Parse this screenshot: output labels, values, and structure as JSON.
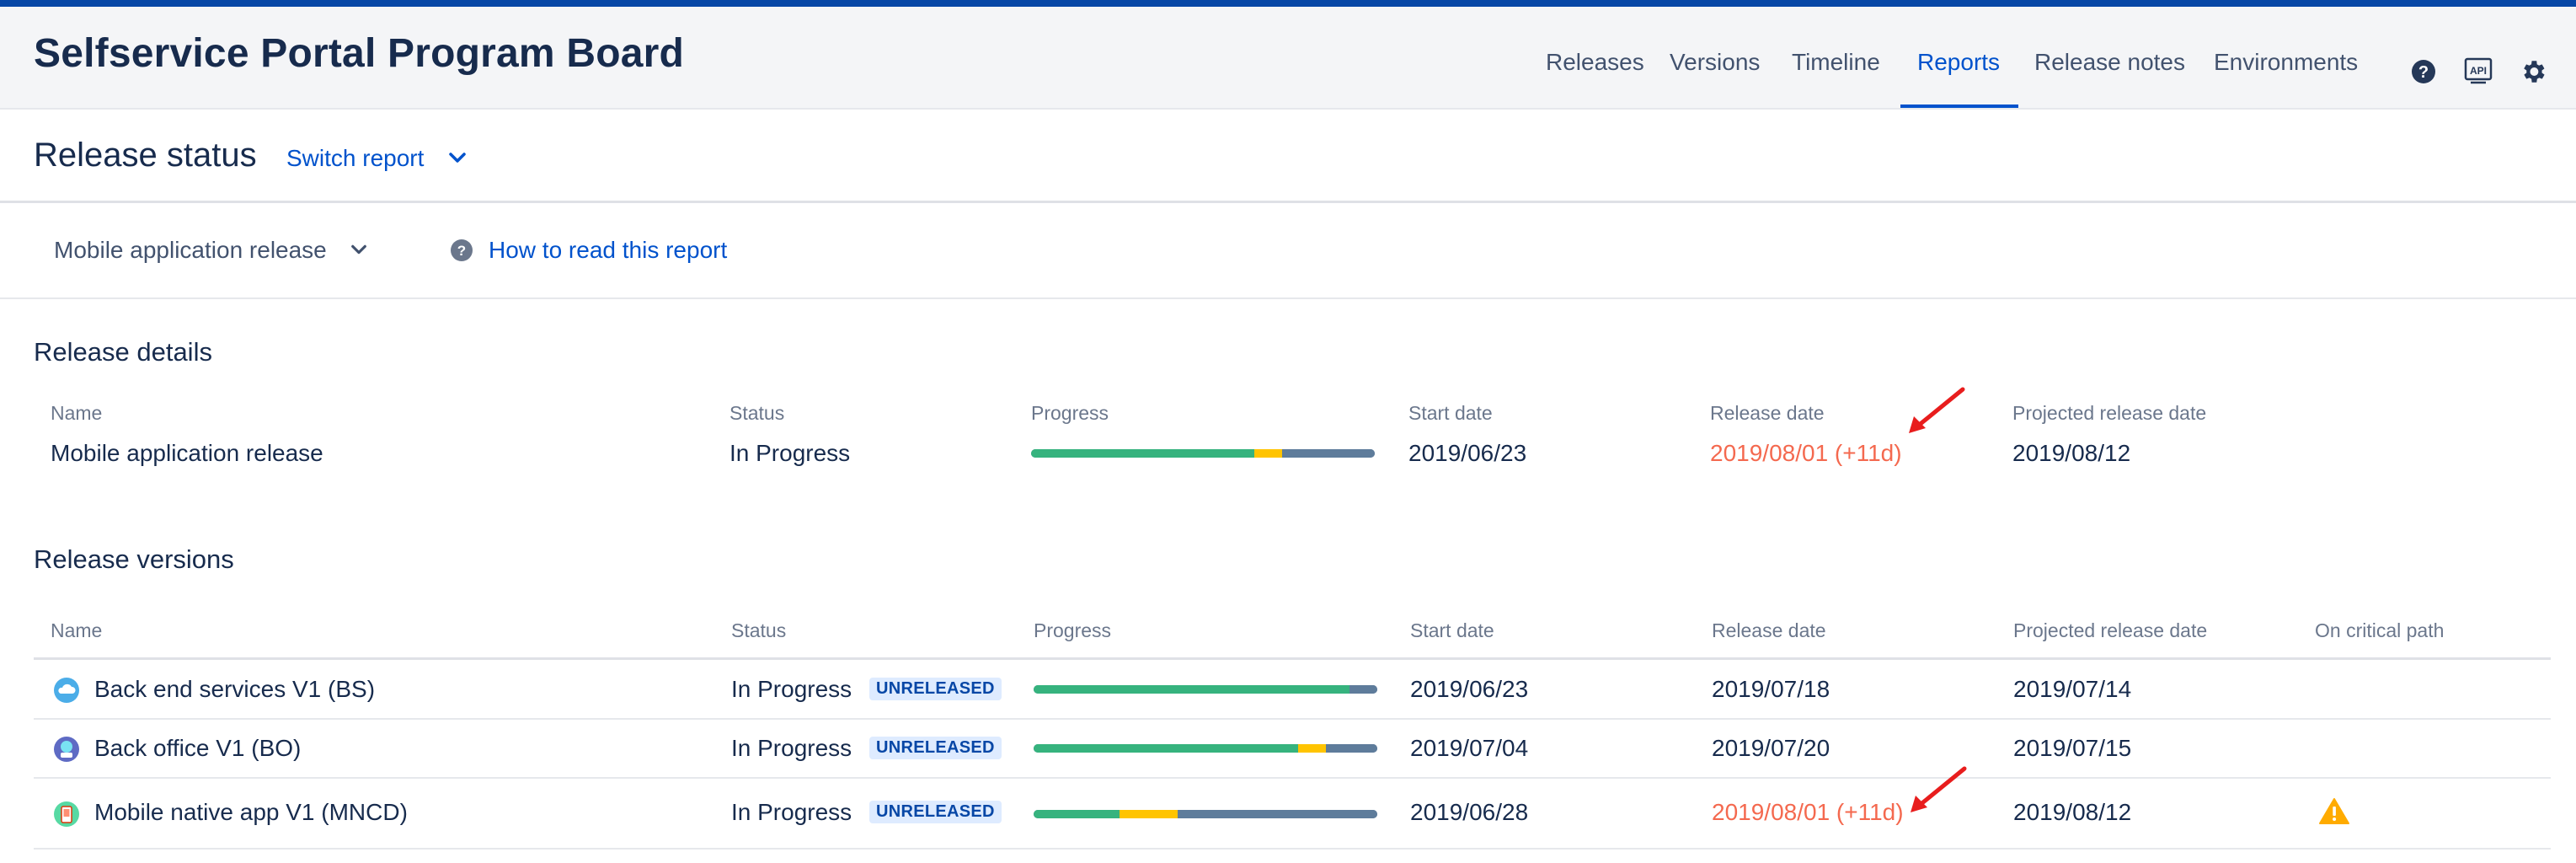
{
  "header": {
    "title": "Selfservice Portal Program Board",
    "nav": [
      "Releases",
      "Versions",
      "Timeline",
      "Reports",
      "Release notes",
      "Environments"
    ],
    "active_nav": "Reports",
    "icons": [
      "help-icon",
      "api-icon",
      "settings-icon"
    ]
  },
  "subheader": {
    "page_title": "Release status",
    "switch_report": "Switch report"
  },
  "filter": {
    "selected_release": "Mobile application release",
    "help_link": "How to read this report"
  },
  "release_details": {
    "section_title": "Release details",
    "columns": [
      "Name",
      "Status",
      "Progress",
      "Start date",
      "Release date",
      "Projected release date"
    ],
    "row": {
      "name": "Mobile application release",
      "status": "In Progress",
      "progress": {
        "done": 0.65,
        "in_progress": 0.08
      },
      "start_date": "2019/06/23",
      "release_date": "2019/08/01 (+11d)",
      "projected_release_date": "2019/08/12"
    }
  },
  "release_versions": {
    "section_title": "Release versions",
    "columns": [
      "Name",
      "Status",
      "Progress",
      "Start date",
      "Release date",
      "Projected release date",
      "On critical path"
    ],
    "rows": [
      {
        "name": "Back end services V1 (BS)",
        "status": "In Progress",
        "badge": "UNRELEASED",
        "progress": {
          "done": 0.92,
          "in_progress": 0.0
        },
        "start_date": "2019/06/23",
        "release_date": "2019/07/18",
        "projected_release_date": "2019/07/14",
        "late": false,
        "critical": false
      },
      {
        "name": "Back office V1 (BO)",
        "status": "In Progress",
        "badge": "UNRELEASED",
        "progress": {
          "done": 0.77,
          "in_progress": 0.08
        },
        "start_date": "2019/07/04",
        "release_date": "2019/07/20",
        "projected_release_date": "2019/07/15",
        "late": false,
        "critical": false
      },
      {
        "name": "Mobile native app V1 (MNCD)",
        "status": "In Progress",
        "badge": "UNRELEASED",
        "progress": {
          "done": 0.25,
          "in_progress": 0.17
        },
        "start_date": "2019/06/28",
        "release_date": "2019/08/01 (+11d)",
        "projected_release_date": "2019/08/12",
        "late": true,
        "critical": true
      }
    ]
  },
  "colors": {
    "accent": "#0052cc",
    "late": "#f4694f",
    "done": "#36b37e",
    "in_progress": "#ffc400",
    "todo": "#5e7c9b",
    "warning": "#ffab00"
  }
}
